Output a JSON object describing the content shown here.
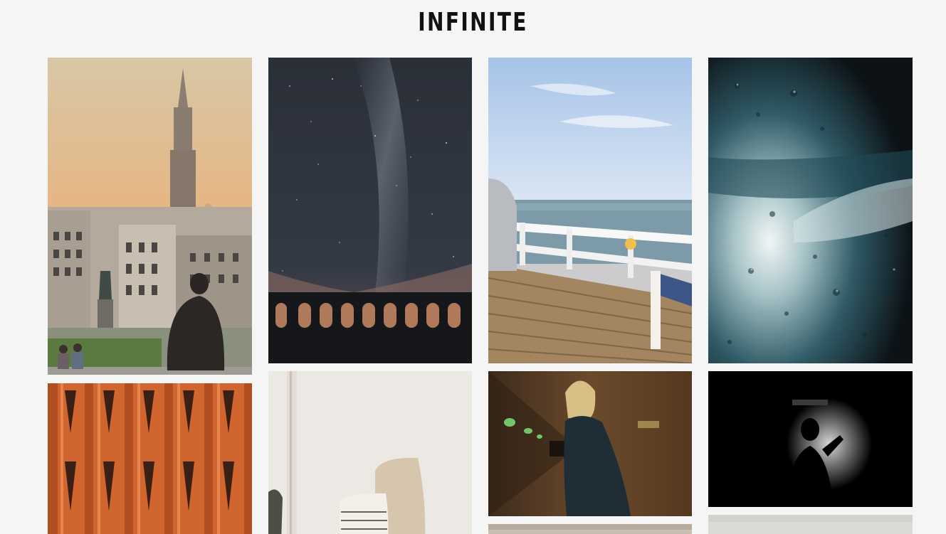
{
  "site": {
    "title": "INFINITE"
  },
  "gallery": {
    "tiles": [
      {
        "name": "photo-city-spire",
        "icon": "city-cathedral-photo"
      },
      {
        "name": "photo-milky-way-viaduct",
        "icon": "night-sky-photo"
      },
      {
        "name": "photo-beach-pier",
        "icon": "seaside-pier-photo"
      },
      {
        "name": "photo-rain-glass",
        "icon": "rain-window-photo"
      },
      {
        "name": "photo-brick-facade",
        "icon": "brick-building-photo"
      },
      {
        "name": "photo-pillow-interior",
        "icon": "interior-pillows-photo"
      },
      {
        "name": "photo-woman-tunnel",
        "icon": "tunnel-portrait-photo"
      },
      {
        "name": "photo-silhouette-dark",
        "icon": "silhouette-photo"
      },
      {
        "name": "photo-sand-partial",
        "icon": "sand-photo"
      },
      {
        "name": "photo-pale-partial",
        "icon": "pale-photo"
      }
    ]
  }
}
